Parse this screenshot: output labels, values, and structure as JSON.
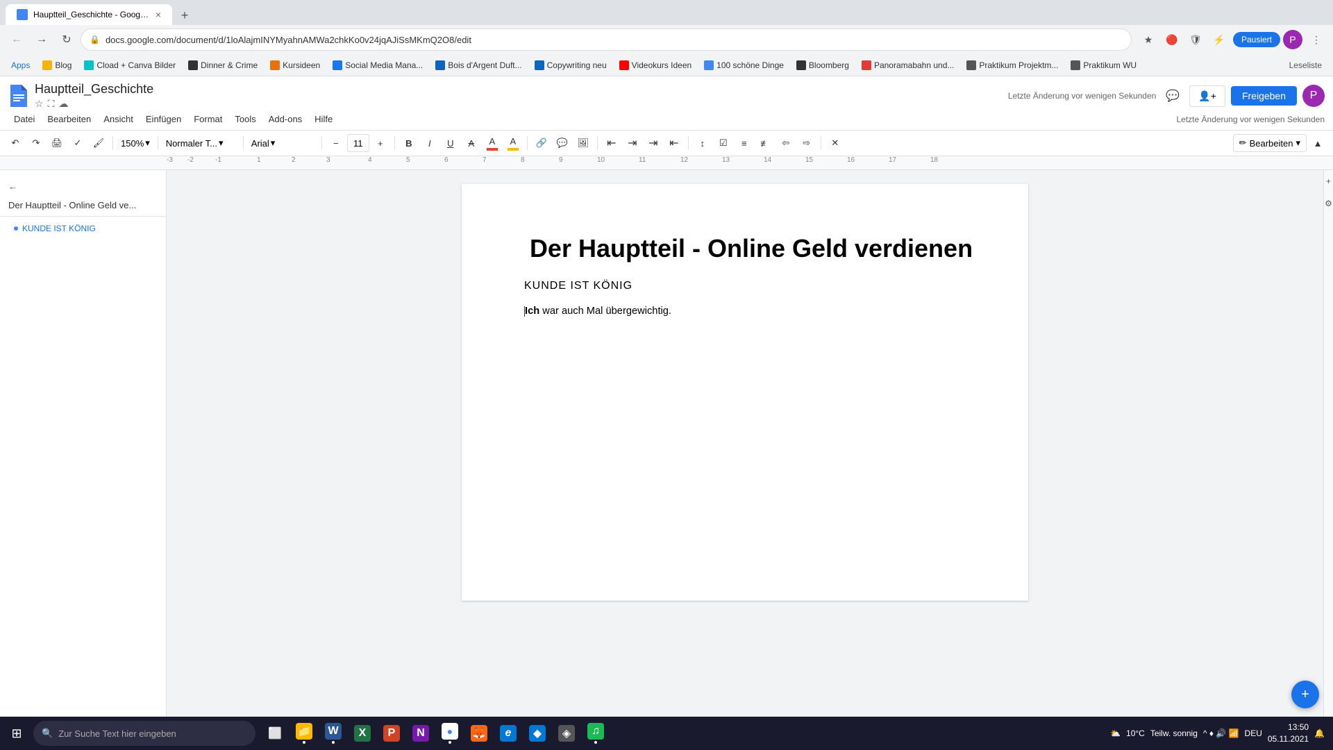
{
  "browser": {
    "tab": {
      "title": "Hauptteil_Geschichte - Google ...",
      "favicon_color": "#4285f4"
    },
    "address": "docs.google.com/document/d/1loAlajmINYMyahnAMWa2chkKo0v24jqAJiSsMKmQ2O8/edit",
    "nav": {
      "pause_label": "Pausiert",
      "user_initial": "P"
    }
  },
  "bookmarks": [
    {
      "label": "Apps",
      "color": "#4285f4"
    },
    {
      "label": "Blog"
    },
    {
      "label": "Cload + Canva Bilder",
      "color": "#4285f4"
    },
    {
      "label": "Dinner & Crime",
      "color": "#231f20"
    },
    {
      "label": "Kursideen"
    },
    {
      "label": "Social Media Mana..."
    },
    {
      "label": "Bois d'Argent Duft...",
      "color": "#0a66c2"
    },
    {
      "label": "Copywriting neu",
      "color": "#0a66c2"
    },
    {
      "label": "Videokurs Ideen"
    },
    {
      "label": "100 schöne Dinge"
    },
    {
      "label": "Bloomberg"
    },
    {
      "label": "Panoramabahn und..."
    },
    {
      "label": "Praktikum Projektm..."
    },
    {
      "label": "Praktikum WU"
    },
    {
      "label": "Leseliste"
    }
  ],
  "docs": {
    "logo_color": "#4285f4",
    "title": "Hauptteil_Geschichte",
    "last_edit": "Letzte Änderung vor wenigen Sekunden",
    "share_label": "Freigeben",
    "edit_label": "Bearbeiten",
    "menu": [
      "Datei",
      "Bearbeiten",
      "Ansicht",
      "Einfügen",
      "Format",
      "Tools",
      "Add-ons",
      "Hilfe"
    ],
    "toolbar": {
      "undo": "↶",
      "redo": "↷",
      "print": "🖨",
      "format_paint": "🖌",
      "spell_check": "✓",
      "zoom": "150%",
      "style": "Normaler T...",
      "font": "Arial",
      "font_size": "11",
      "bold": "B",
      "italic": "I",
      "underline": "U",
      "strikethrough": "S",
      "text_color": "A",
      "highlight": "A",
      "link": "🔗",
      "comment": "💬",
      "image": "🖼",
      "align_left": "≡",
      "align_center": "≡",
      "align_right": "≡",
      "align_justify": "≡",
      "line_spacing": "↕",
      "list_bullet": "≡",
      "list_numbered": "≡",
      "indent_less": "←",
      "indent_more": "→",
      "clear_format": "✕"
    }
  },
  "sidebar": {
    "back_label": "←",
    "doc_title": "Der Hauptteil - Online Geld ve...",
    "outline_items": [
      {
        "label": "KUNDE IST KÖNIG",
        "level": 1
      }
    ]
  },
  "document": {
    "heading": "Der Hauptteil - Online Geld verdienen",
    "subheading": "KUNDE IST KÖNIG",
    "paragraph": "war auch Mal übergewichtig.",
    "paragraph_bold": "Ich"
  },
  "taskbar": {
    "search_placeholder": "Zur Suche Text hier eingeben",
    "apps": [
      {
        "name": "windows",
        "icon": "⊞",
        "color": "#0078d4"
      },
      {
        "name": "search",
        "icon": "🔍",
        "color": "#2d2d44"
      },
      {
        "name": "task-view",
        "icon": "⬜",
        "color": "#0078d4"
      },
      {
        "name": "explorer",
        "icon": "📁",
        "color": "#ffb900"
      },
      {
        "name": "word",
        "icon": "W",
        "color": "#2b5797"
      },
      {
        "name": "excel",
        "icon": "X",
        "color": "#217346"
      },
      {
        "name": "powerpoint",
        "icon": "P",
        "color": "#d04423"
      },
      {
        "name": "onenote",
        "icon": "N",
        "color": "#7719aa"
      },
      {
        "name": "chrome",
        "icon": "●",
        "color": "#4285f4"
      },
      {
        "name": "firefox",
        "icon": "🦊",
        "color": "#ff6611"
      },
      {
        "name": "edge",
        "icon": "e",
        "color": "#0078d4"
      },
      {
        "name": "misc1",
        "icon": "◆",
        "color": "#0078d4"
      },
      {
        "name": "misc2",
        "icon": "◈",
        "color": "#555"
      },
      {
        "name": "spotify",
        "icon": "♫",
        "color": "#1db954"
      }
    ],
    "system": {
      "temp": "10°C",
      "weather": "Teilw. sonnig",
      "time": "13:50",
      "date": "05.11.2021",
      "language": "DEU"
    }
  }
}
